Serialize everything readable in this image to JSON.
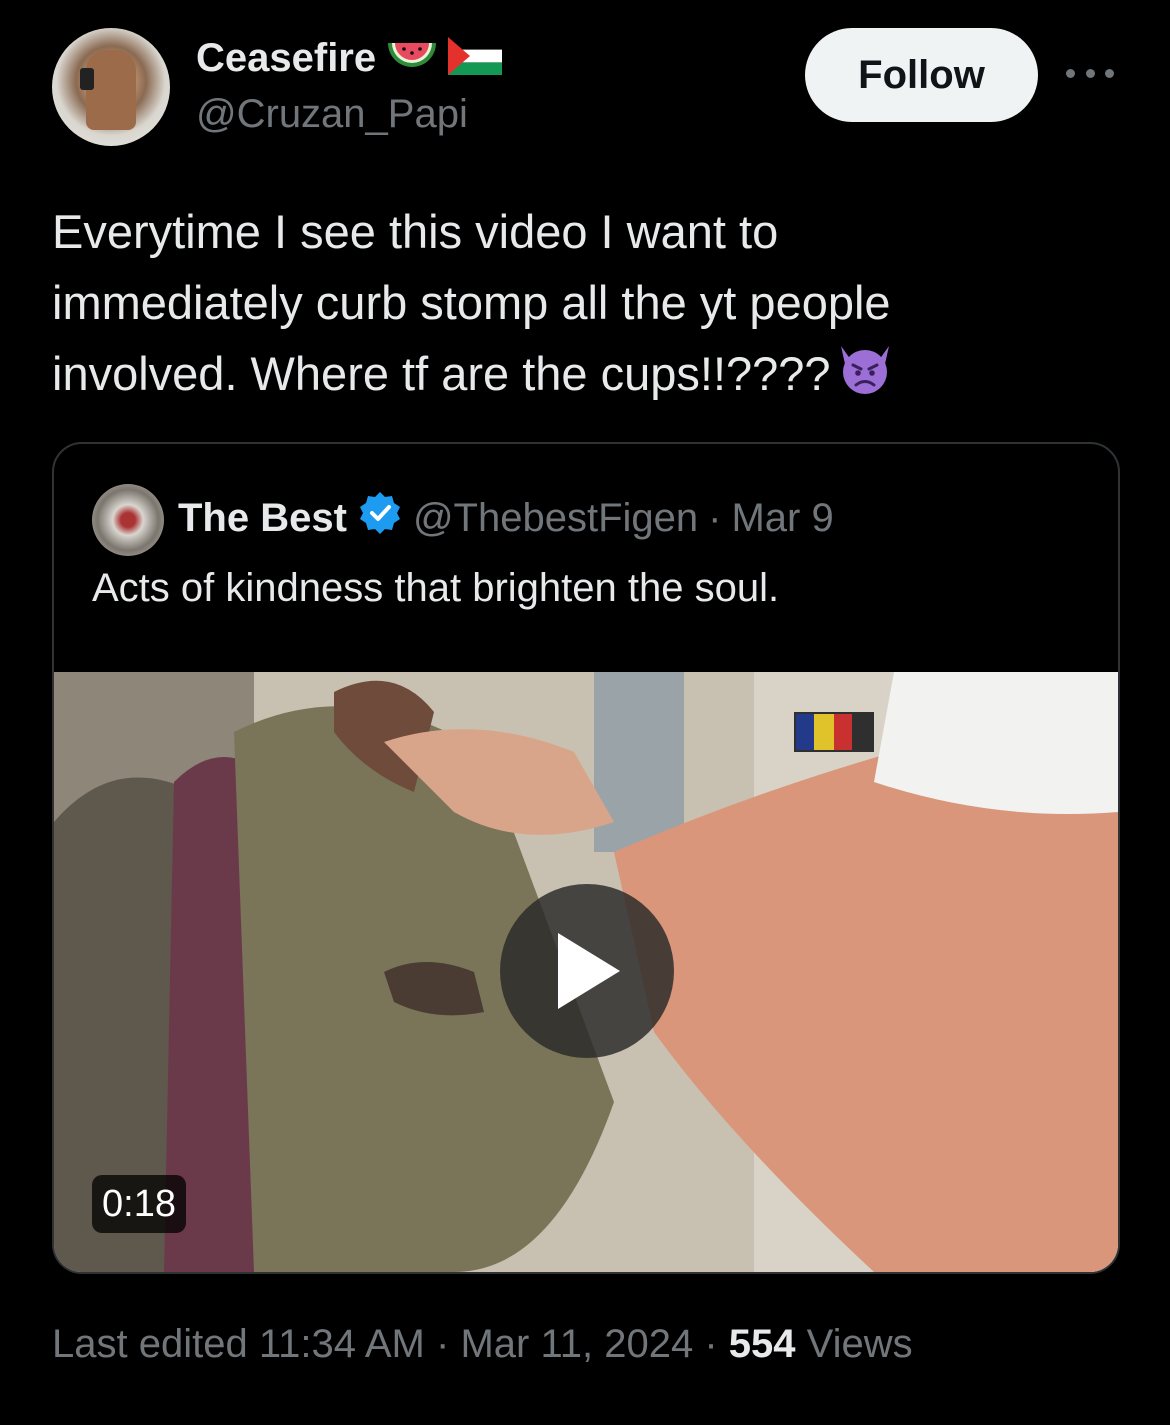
{
  "author": {
    "display_name": "Ceasefire",
    "handle": "@Cruzan_Papi",
    "name_emojis": [
      "watermelon-icon",
      "palestine-flag-icon"
    ]
  },
  "actions": {
    "follow_label": "Follow",
    "more_icon": "more-horizontal-icon"
  },
  "tweet": {
    "lines": [
      "Everytime I see this video I want  to",
      "immediately curb stomp all the yt people",
      "involved. Where tf are the cups!!????"
    ],
    "trailing_emoji": "angry-devil-icon"
  },
  "quoted": {
    "display_name": "The Best",
    "verified_icon": "verified-badge-icon",
    "handle": "@ThebestFigen",
    "separator": "·",
    "date": "Mar 9",
    "text": "Acts of kindness that brighten the soul.",
    "video": {
      "duration": "0:18",
      "play_icon": "play-icon"
    }
  },
  "meta": {
    "edited_label": "Last edited",
    "time": "11:34 AM",
    "separator": "·",
    "date": "Mar 11, 2024",
    "views_count": "554",
    "views_label": "Views"
  },
  "colors": {
    "background": "#000000",
    "text_primary": "#e7e9ea",
    "text_secondary": "#71767b",
    "border": "#2f3336",
    "verified": "#1d9bf0"
  }
}
